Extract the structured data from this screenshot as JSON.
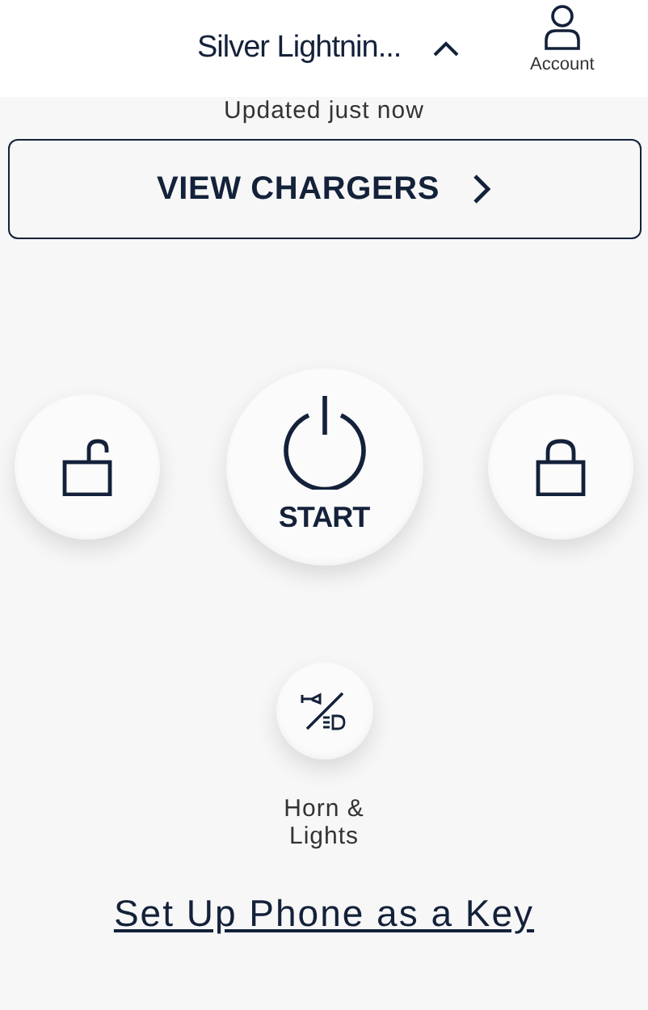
{
  "header": {
    "vehicle_name": "Silver Lightnin...",
    "account_label": "Account"
  },
  "status": "Updated just now",
  "chargers_button": {
    "label": "VIEW CHARGERS"
  },
  "controls": {
    "start_label": "START"
  },
  "horn_lights": {
    "label": "Horn & Lights"
  },
  "phone_key_link": "Set Up Phone as a Key"
}
